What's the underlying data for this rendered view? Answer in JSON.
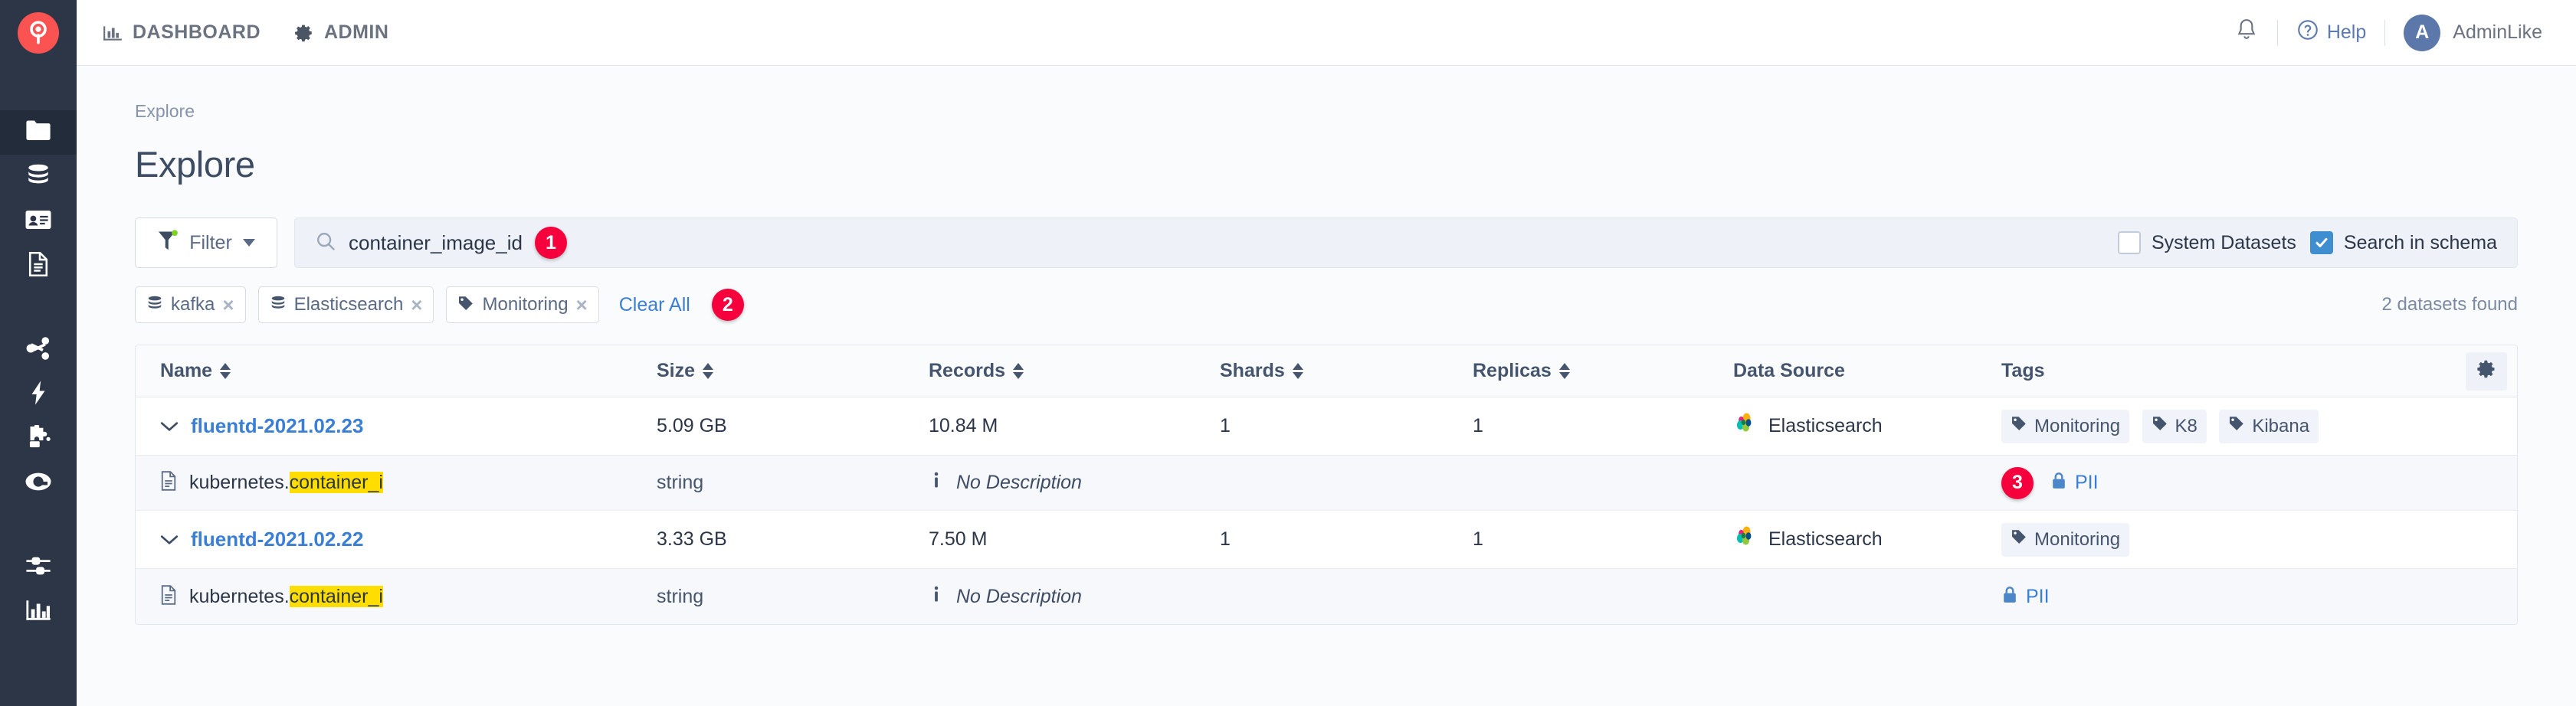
{
  "topbar": {
    "logo_icon": "search-pin-logo",
    "nav": [
      {
        "label": "DASHBOARD",
        "icon": "bar-chart-icon"
      },
      {
        "label": "ADMIN",
        "icon": "gear-icon"
      }
    ],
    "notification_icon": "bell-icon",
    "help_label": "Help",
    "help_icon": "question-circle-icon",
    "avatar_initial": "A",
    "user_name": "AdminLike",
    "accent_color": "#fb5252",
    "link_color": "#3a7fd5"
  },
  "sidebar": {
    "items": [
      {
        "icon": "folder-icon",
        "active": true
      },
      {
        "icon": "database-icon",
        "active": false
      },
      {
        "icon": "id-card-icon",
        "active": false
      },
      {
        "icon": "document-icon",
        "active": false
      },
      {
        "icon": "share-nodes-icon",
        "active": false
      },
      {
        "icon": "lightning-bolt-icon",
        "active": false
      },
      {
        "icon": "puzzle-piece-icon",
        "active": false
      },
      {
        "icon": "search-circle-icon",
        "active": false
      },
      {
        "icon": "sliders-icon",
        "active": false
      },
      {
        "icon": "bar-chart-icon",
        "active": false
      }
    ]
  },
  "page": {
    "breadcrumb": "Explore",
    "title": "Explore"
  },
  "search": {
    "filter_label": "Filter",
    "filter_icon": "funnel-icon",
    "search_icon": "magnifier-icon",
    "query": "container_image_id",
    "query_badge": "1",
    "checkboxes": [
      {
        "label": "System Datasets",
        "checked": false
      },
      {
        "label": "Search in schema",
        "checked": true
      }
    ]
  },
  "chips": {
    "items": [
      {
        "label": "kafka",
        "icon": "database-icon"
      },
      {
        "label": "Elasticsearch",
        "icon": "database-icon"
      },
      {
        "label": "Monitoring",
        "icon": "tag-icon"
      }
    ],
    "remove_glyph": "×",
    "clear_all_label": "Clear All",
    "clear_all_badge": "2",
    "results_text": "2 datasets found"
  },
  "table": {
    "columns": [
      {
        "label": "Name",
        "sortable": true
      },
      {
        "label": "Size",
        "sortable": true
      },
      {
        "label": "Records",
        "sortable": true
      },
      {
        "label": "Shards",
        "sortable": true
      },
      {
        "label": "Replicas",
        "sortable": true
      },
      {
        "label": "Data Source",
        "sortable": false
      },
      {
        "label": "Tags",
        "sortable": false
      }
    ],
    "settings_icon": "gear-icon",
    "rows": [
      {
        "name": "fluentd-2021.02.23",
        "size": "5.09 GB",
        "records": "10.84 M",
        "shards": "1",
        "replicas": "1",
        "data_source": "Elasticsearch",
        "data_source_icon": "elasticsearch-logo",
        "tags": [
          "Monitoring",
          "K8",
          "Kibana"
        ],
        "expanded": true,
        "fields": [
          {
            "prefix": "kubernetes.",
            "highlight": "container_i",
            "type": "string",
            "description": "No Description",
            "badge": "3",
            "pii_label": "PII"
          }
        ]
      },
      {
        "name": "fluentd-2021.02.22",
        "size": "3.33 GB",
        "records": "7.50 M",
        "shards": "1",
        "replicas": "1",
        "data_source": "Elasticsearch",
        "data_source_icon": "elasticsearch-logo",
        "tags": [
          "Monitoring"
        ],
        "expanded": true,
        "fields": [
          {
            "prefix": "kubernetes.",
            "highlight": "container_i",
            "type": "string",
            "description": "No Description",
            "badge": "",
            "pii_label": "PII"
          }
        ]
      }
    ]
  }
}
